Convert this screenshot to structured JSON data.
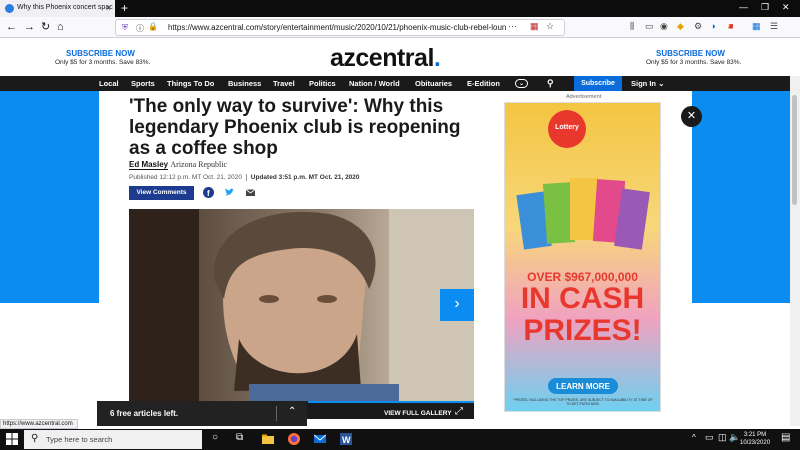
{
  "browser": {
    "tab_title": "Why this Phoenix concert spac",
    "url": "https://www.azcentral.com/story/entertainment/music/2020/10/21/phoenix-music-club-rebel-loun",
    "status_url": "https://www.azcentral.com",
    "extension_badge": "3"
  },
  "header": {
    "left_subscribe_title": "SUBSCRIBE NOW",
    "left_subscribe_desc": "Only $5 for 3 months. Save 83%.",
    "logo_text": "azcentral",
    "logo_dot": ".",
    "right_subscribe_title": "SUBSCRIBE NOW",
    "right_subscribe_desc": "Only $5 for 3 months. Save 83%."
  },
  "nav": {
    "items": [
      "Local",
      "Sports",
      "Things To Do",
      "Business",
      "Travel",
      "Politics",
      "Nation / World",
      "Obituaries",
      "E-Edition"
    ],
    "subscribe": "Subscribe",
    "sign_in": "Sign In"
  },
  "article": {
    "headline": "'The only way to survive': Why this legendary Phoenix club is reopening as a coffee shop",
    "author": "Ed Masley",
    "publication": "Arizona Republic",
    "published": "Published 12:12 p.m. MT Oct. 21, 2020",
    "updated": "Updated 3:51 p.m. MT Oct. 21, 2020",
    "view_comments": "View Comments",
    "gallery_label": "VIEW FULL GALLERY",
    "gallery_progress": 0.48
  },
  "paywall": {
    "free_articles": "6 free articles left."
  },
  "ad": {
    "label": "Advertisement",
    "brand": "Lottery",
    "amount": "OVER $967,000,000",
    "line1": "IN CASH",
    "line2": "PRIZES!",
    "button": "LEARN MORE",
    "fine_print": "*PRIZES, INCLUDING THE TOP PRIZES, ARE SUBJECT TO AVAILABILITY AT TIME OF TICKET PURCHASE."
  },
  "taskbar": {
    "search_placeholder": "Type here to search",
    "time": "3:21 PM",
    "date": "10/23/2020"
  },
  "colors": {
    "accent": "#0a6cdb",
    "side_blue": "#0a8cf0",
    "nav_bg": "#1a1a1a",
    "comments_btn": "#1d3c8f",
    "ad_red": "#e8382e"
  }
}
